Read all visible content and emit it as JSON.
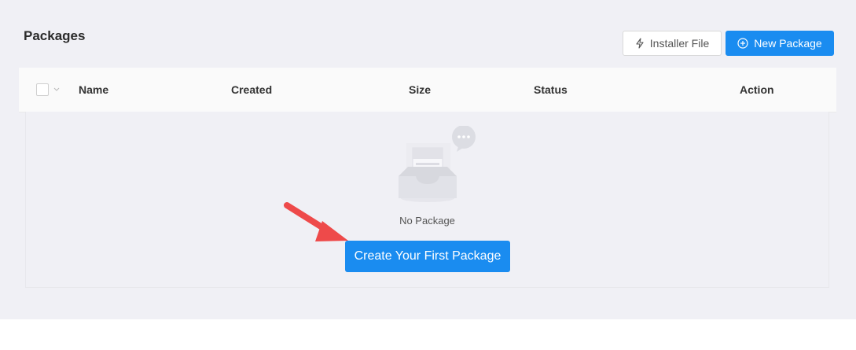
{
  "header": {
    "title": "Packages",
    "installer_button_label": "Installer File",
    "new_package_button_label": "New Package"
  },
  "table": {
    "columns": [
      "Name",
      "Created",
      "Size",
      "Status",
      "Action"
    ]
  },
  "empty_state": {
    "message": "No Package",
    "create_button_label": "Create Your First Package"
  },
  "colors": {
    "primary": "#1a8cf0",
    "background": "#f0f0f5",
    "annotation_arrow": "#f04e4e"
  },
  "icons": {
    "installer": "lightning-bolt-icon",
    "new_package": "plus-circle-icon",
    "select_all_dropdown": "chevron-down-icon",
    "empty": "empty-inbox-icon"
  }
}
